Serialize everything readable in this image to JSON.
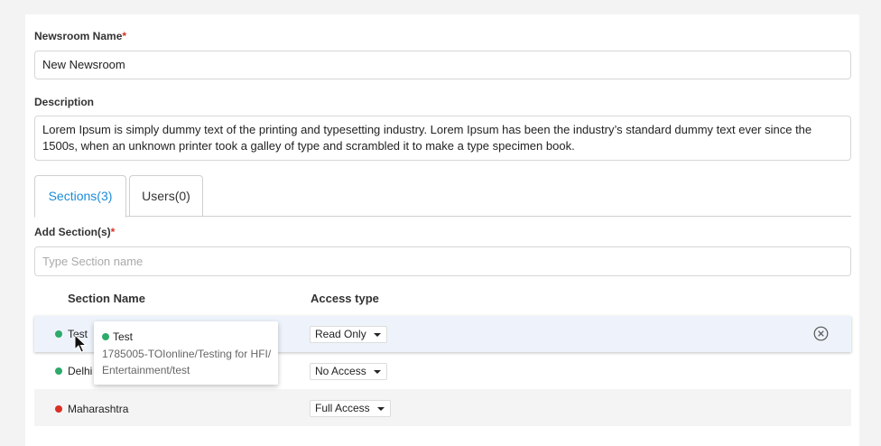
{
  "form": {
    "name_label": "Newsroom Name",
    "name_required_mark": "*",
    "name_value": "New Newsroom",
    "description_label": "Description",
    "description_value": "Lorem Ipsum is simply dummy text of the printing and typesetting industry. Lorem Ipsum has been the industry’s standard dummy text ever since the 1500s, when an unknown printer took a galley of type and scrambled it to make a type specimen book."
  },
  "tabs": [
    {
      "label": "Sections(3)",
      "active": true
    },
    {
      "label": "Users(0)",
      "active": false
    }
  ],
  "sections": {
    "add_label": "Add Section(s)",
    "add_required_mark": "*",
    "input_placeholder": "Type Section name",
    "columns": {
      "name": "Section Name",
      "access": "Access type"
    },
    "rows": [
      {
        "name": "Test",
        "status_color": "#2eaa6b",
        "access": "Read Only"
      },
      {
        "name": "Delhi",
        "status_color": "#2eaa6b",
        "access": "No Access"
      },
      {
        "name": "Maharashtra",
        "status_color": "#d93025",
        "access": "Full Access"
      }
    ]
  },
  "tooltip": {
    "title": "Test",
    "status_color": "#2eaa6b",
    "path": "1785005-TOIonline/Testing for HFI/ Entertainment/test"
  },
  "colors": {
    "accent": "#1a8cd8",
    "required": "#d93025",
    "active_row": "#eef3fb"
  }
}
